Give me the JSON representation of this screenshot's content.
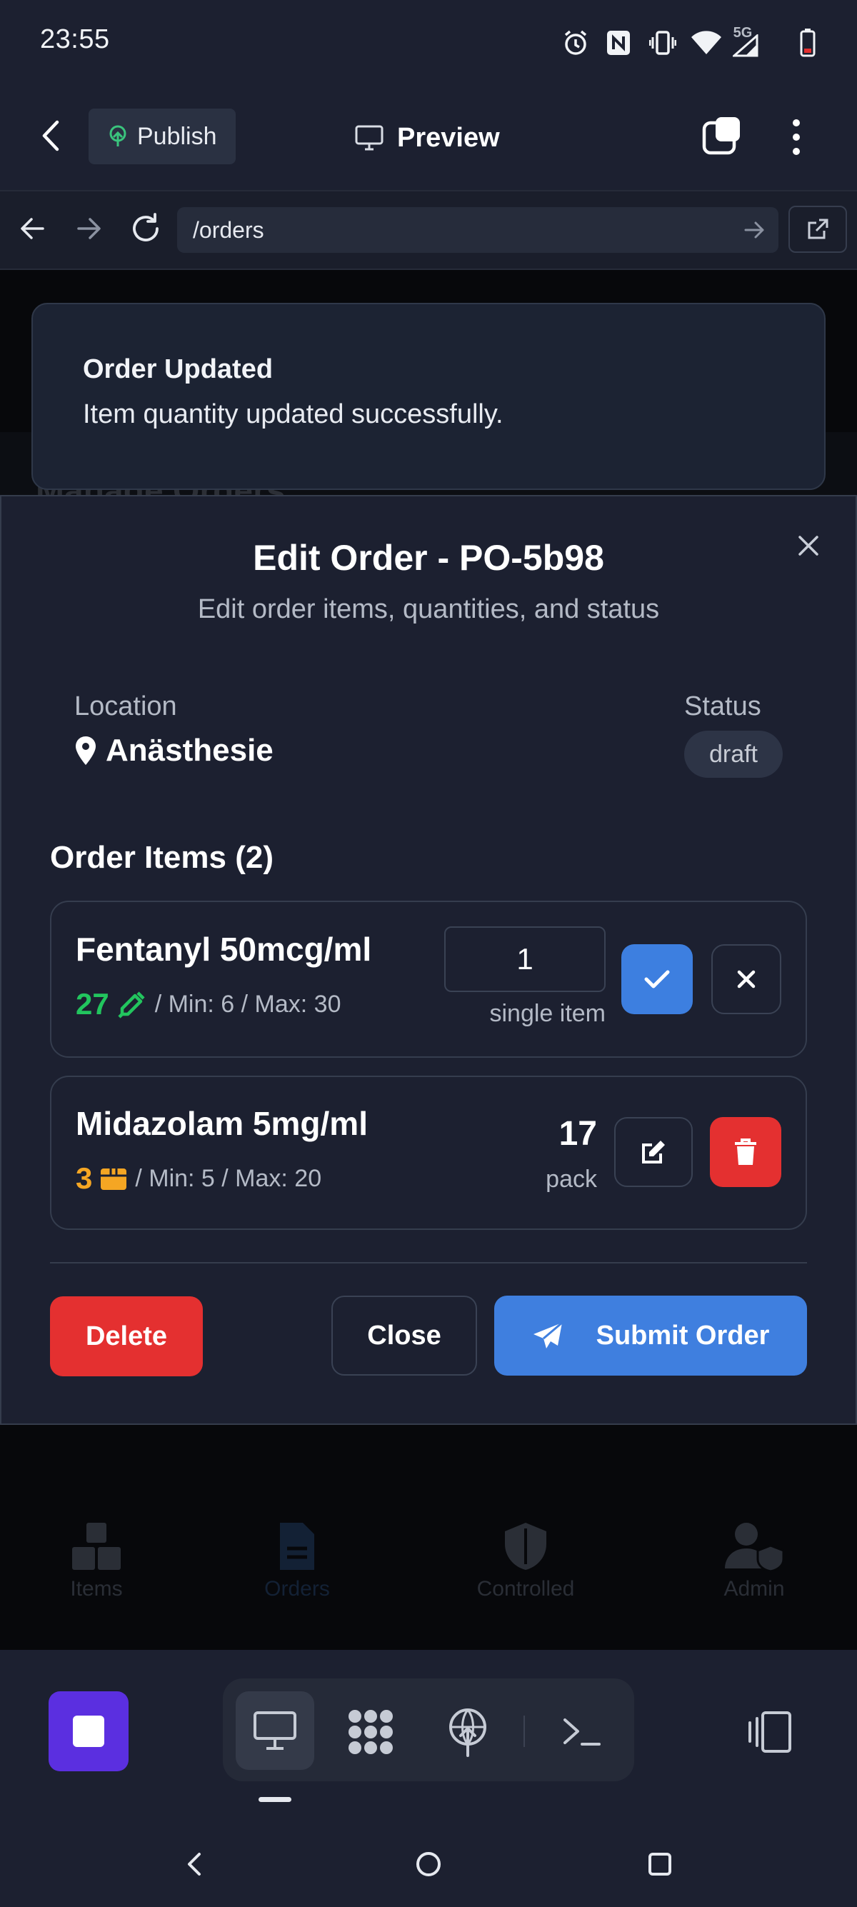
{
  "status_bar": {
    "time": "23:55",
    "network": "5G"
  },
  "toolbar": {
    "publish_label": "Publish",
    "preview_label": "Preview"
  },
  "browser": {
    "url": "/orders"
  },
  "background": {
    "heading": "Manage Orders",
    "nav": [
      {
        "label": "Items"
      },
      {
        "label": "Orders"
      },
      {
        "label": "Controlled"
      },
      {
        "label": "Admin"
      }
    ]
  },
  "toast": {
    "title": "Order Updated",
    "message": "Item quantity updated successfully."
  },
  "dialog": {
    "title": "Edit Order - PO-5b98",
    "subtitle": "Edit order items, quantities, and status",
    "location_label": "Location",
    "location_value": "Anästhesie",
    "status_label": "Status",
    "status_value": "draft",
    "items_title": "Order Items (2)",
    "items": [
      {
        "name": "Fentanyl 50mcg/ml",
        "stock": "27",
        "meta": "/ Min: 6 / Max: 30",
        "stock_color": "#22c55e",
        "icon": "syringe-icon",
        "qty": "1",
        "unit": "single item",
        "editing": true
      },
      {
        "name": "Midazolam 5mg/ml",
        "stock": "3",
        "meta": "/ Min: 5 / Max: 20",
        "stock_color": "#f5a623",
        "icon": "box-icon",
        "qty": "17",
        "unit": "pack",
        "editing": false
      }
    ],
    "delete_label": "Delete",
    "close_label": "Close",
    "submit_label": "Submit Order"
  },
  "colors": {
    "accent": "#3f7fdf",
    "danger": "#e43030",
    "stop": "#5b2fe0"
  }
}
